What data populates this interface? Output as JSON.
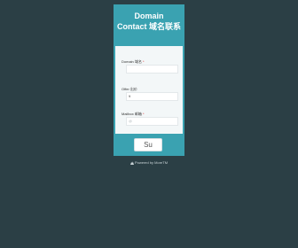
{
  "header": {
    "title_line1": "Domain",
    "title_line2": "Contact 域名联系"
  },
  "form": {
    "fields": [
      {
        "label": "Domain 域名",
        "required": "*",
        "value": "",
        "placeholder": ""
      },
      {
        "label": "Offer 出价",
        "required": "",
        "value": "¥",
        "placeholder": ""
      },
      {
        "label": "Mailbox 邮箱",
        "required": "*",
        "value": "",
        "placeholder": "@"
      }
    ],
    "submit_label": "Su"
  },
  "footer": {
    "powered_text": "Powered by MoreTM"
  },
  "colors": {
    "background": "#2b3f45",
    "accent": "#3aa2b1",
    "card_body": "#f3f7f8"
  }
}
